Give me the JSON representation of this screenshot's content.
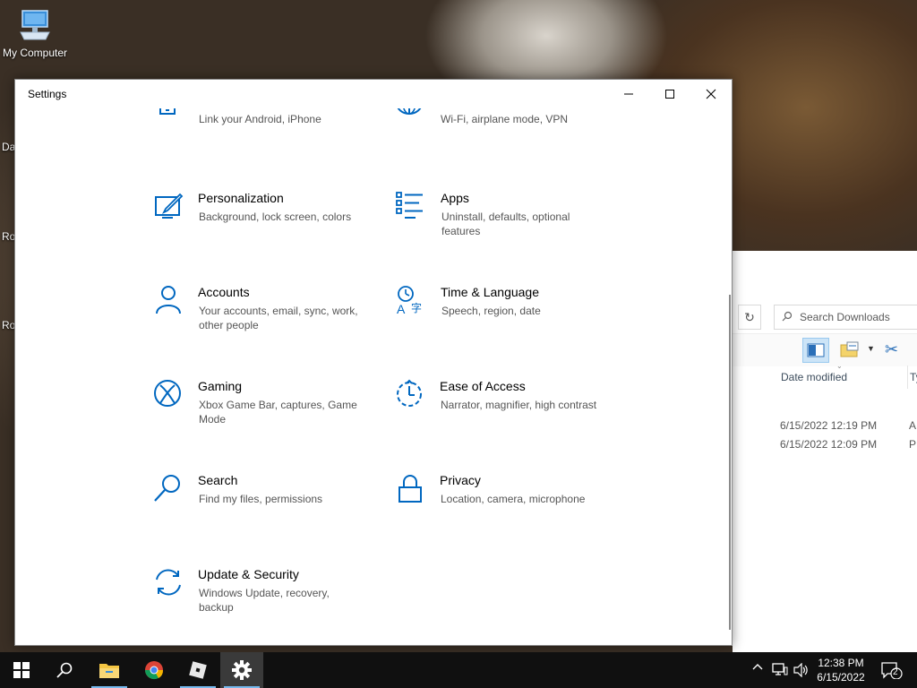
{
  "desktop": {
    "icon_label": "My Computer",
    "cut_labels": [
      "Da",
      "Ro",
      "Ro"
    ]
  },
  "explorer": {
    "search_placeholder": "Search Downloads",
    "col_date": "Date modified",
    "col_type": "Ty",
    "rows": [
      {
        "date": "6/15/2022 12:19 PM",
        "type": "A"
      },
      {
        "date": "6/15/2022 12:09 PM",
        "type": "P"
      }
    ]
  },
  "settings": {
    "title": "Settings",
    "tiles": [
      {
        "name": "",
        "desc": "Link your Android, iPhone",
        "icon": "phone-icon"
      },
      {
        "name": "",
        "desc": "Wi-Fi, airplane mode, VPN",
        "icon": "globe-icon"
      },
      {
        "name": "Personalization",
        "desc": "Background, lock screen, colors",
        "icon": "personalization-icon"
      },
      {
        "name": "Apps",
        "desc": "Uninstall, defaults, optional features",
        "icon": "apps-icon"
      },
      {
        "name": "Accounts",
        "desc": "Your accounts, email, sync, work, other people",
        "icon": "person-icon"
      },
      {
        "name": "Time & Language",
        "desc": "Speech, region, date",
        "icon": "time-language-icon"
      },
      {
        "name": "Gaming",
        "desc": "Xbox Game Bar, captures, Game Mode",
        "icon": "xbox-icon"
      },
      {
        "name": "Ease of Access",
        "desc": "Narrator, magnifier, high contrast",
        "icon": "ease-of-access-icon"
      },
      {
        "name": "Search",
        "desc": "Find my files, permissions",
        "icon": "search-icon"
      },
      {
        "name": "Privacy",
        "desc": "Location, camera, microphone",
        "icon": "lock-icon"
      },
      {
        "name": "Update & Security",
        "desc": "Windows Update, recovery, backup",
        "icon": "update-icon"
      }
    ]
  },
  "taskbar": {
    "apps": [
      "start-icon",
      "search-icon",
      "file-explorer-icon",
      "chrome-icon",
      "roblox-icon",
      "settings-gear-icon"
    ],
    "clock_time": "12:38 PM",
    "clock_date": "6/15/2022",
    "notification_count": "2"
  },
  "colors": {
    "accent": "#0067c0",
    "taskbar": "#101010",
    "active_underline": "#76b9ed"
  }
}
